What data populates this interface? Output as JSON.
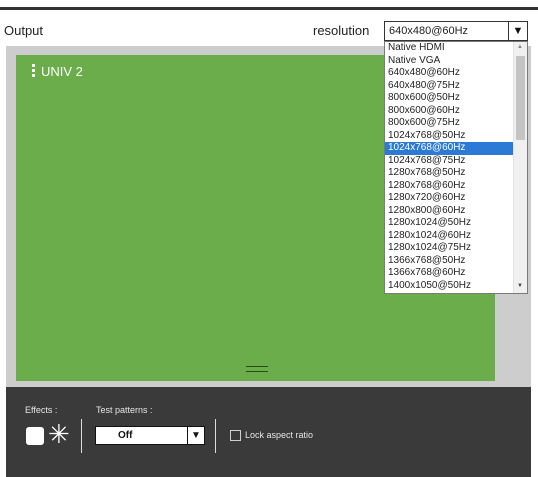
{
  "header": {
    "title": "Output",
    "resolution_label": "resolution",
    "resolution_value": "640x480@60Hz",
    "dropdown_arrow": "▼"
  },
  "canvas": {
    "label": "UNIV 2",
    "color": "#6cad4b",
    "menu_icon": "vertical-dots-icon",
    "resize_icon": "drag-handle-icon"
  },
  "resolution_options": [
    "Native HDMI",
    "Native VGA",
    "640x480@60Hz",
    "640x480@75Hz",
    "800x600@50Hz",
    "800x600@60Hz",
    "800x600@75Hz",
    "1024x768@50Hz",
    "1024x768@60Hz",
    "1024x768@75Hz",
    "1280x768@50Hz",
    "1280x768@60Hz",
    "1280x720@60Hz",
    "1280x800@60Hz",
    "1280x1024@50Hz",
    "1280x1024@60Hz",
    "1280x1024@75Hz",
    "1366x768@50Hz",
    "1366x768@60Hz",
    "1400x1050@50Hz"
  ],
  "highlighted_option": "1024x768@60Hz",
  "bottom": {
    "effects_label": "Effects :",
    "test_patterns_label": "Test patterns :",
    "test_pattern_value": "Off",
    "test_pattern_arrow": "▼",
    "lock_label": "Lock aspect ratio",
    "star_glyph": "✳"
  },
  "colors": {
    "accent_selected": "#2b7bd6",
    "bottom_bar": "#3a3a3a",
    "panel": "#cdcdcd"
  }
}
